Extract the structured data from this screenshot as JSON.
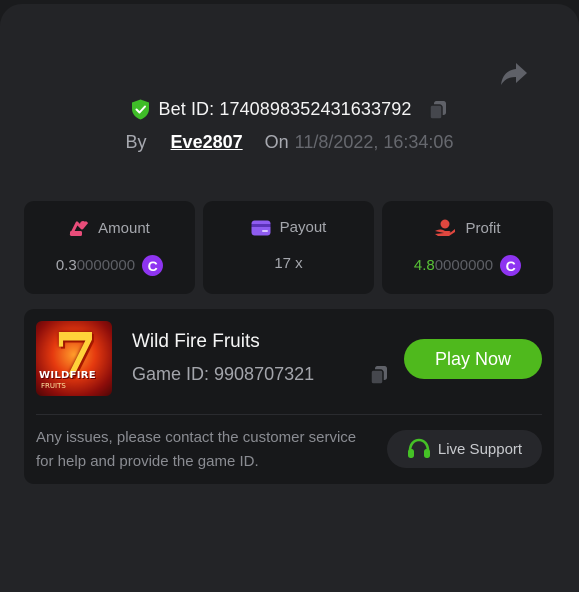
{
  "header": {
    "bet_label": "Bet ID: 1740898352431633792",
    "by_label": "By",
    "username": "Eve2807",
    "on_label": "On",
    "datetime": "11/8/2022, 16:34:06"
  },
  "stats": {
    "amount": {
      "label": "Amount",
      "value_main": "0.3",
      "value_dim": "0000000",
      "coin": "C"
    },
    "payout": {
      "label": "Payout",
      "value": "17 x"
    },
    "profit": {
      "label": "Profit",
      "value_main": "4.8",
      "value_dim": "0000000",
      "coin": "C"
    }
  },
  "game": {
    "thumb_title": "WILDFIRE",
    "thumb_sub": "FRUITS",
    "name": "Wild Fire Fruits",
    "id_label": "Game ID: 9908707321",
    "play_label": "Play Now"
  },
  "support": {
    "notice": "Any issues, please contact the customer service for help and provide the game ID.",
    "button_label": "Live Support"
  },
  "icons": [
    "share-icon",
    "shield-check-icon",
    "copy-icon",
    "amount-icon",
    "payout-card-icon",
    "profit-hand-icon",
    "coin-icon",
    "headset-icon"
  ],
  "colors": {
    "accent_green": "#4fb91d",
    "profit_green": "#58c236",
    "coin_purple": "#8e34f1",
    "amount_pink": "#e94d7a",
    "payout_purple": "#8e5cf0",
    "profit_red": "#e0473f"
  }
}
